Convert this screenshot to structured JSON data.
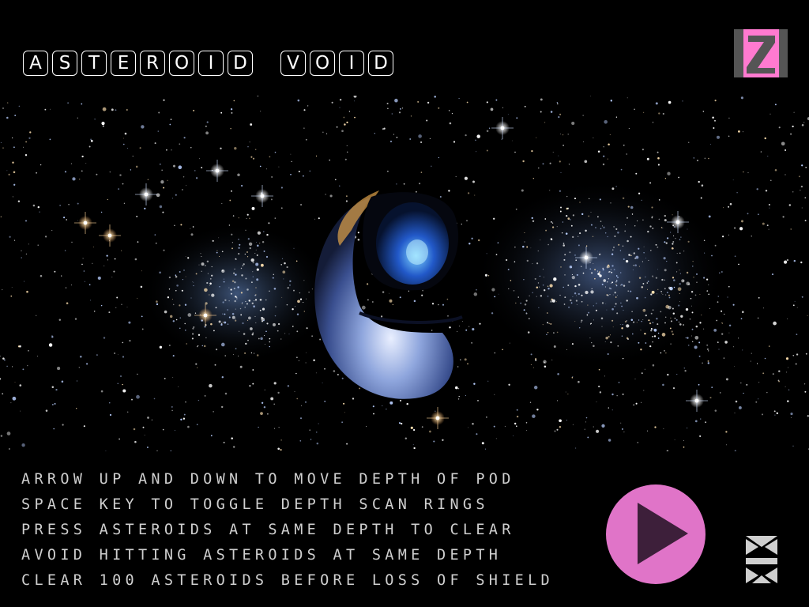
{
  "title": {
    "words": [
      [
        "A",
        "S",
        "T",
        "E",
        "R",
        "O",
        "I",
        "D"
      ],
      [
        "V",
        "O",
        "I",
        "D"
      ]
    ]
  },
  "logo": {
    "letter": "Z",
    "color": "#ff7ad0"
  },
  "instructions": [
    "ARROW UP AND DOWN TO MOVE DEPTH OF POD",
    "SPACE KEY TO TOGGLE DEPTH SCAN RINGS",
    "PRESS ASTEROIDS AT SAME DEPTH TO CLEAR",
    "AVOID HITTING ASTEROIDS AT SAME DEPTH",
    "CLEAR 100 ASTEROIDS BEFORE LOSS OF SHIELD"
  ],
  "play_button": {
    "icon": "play-icon",
    "color": "#e074c8"
  },
  "corner_logo": {
    "icon": "studio-logo-icon"
  },
  "colors": {
    "background": "#000000",
    "text": "#cfcfcf",
    "accent": "#e074c8"
  }
}
